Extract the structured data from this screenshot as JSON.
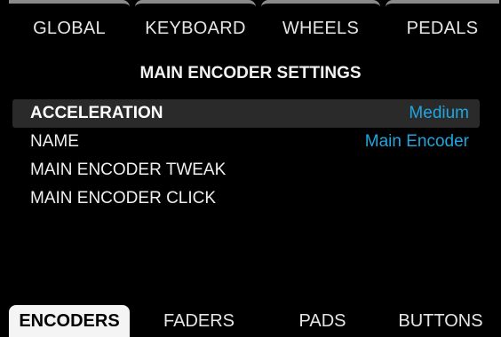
{
  "top_tabs": [
    {
      "label": "GLOBAL"
    },
    {
      "label": "KEYBOARD"
    },
    {
      "label": "WHEELS"
    },
    {
      "label": "PEDALS"
    }
  ],
  "page_title": "MAIN ENCODER SETTINGS",
  "menu": [
    {
      "name": "ACCELERATION",
      "value": "Medium"
    },
    {
      "name": "NAME",
      "value": "Main Encoder"
    },
    {
      "name": "MAIN ENCODER TWEAK"
    },
    {
      "name": "MAIN ENCODER CLICK"
    }
  ],
  "bottom_tabs": [
    {
      "label": "ENCODERS",
      "selected": true
    },
    {
      "label": "FADERS"
    },
    {
      "label": "PADS"
    },
    {
      "label": "BUTTONS"
    }
  ],
  "colors": {
    "background": "#000000",
    "value_accent": "#1fa6e0",
    "selected_row": "#2a2a2a",
    "selected_tab": "#f4f4f4",
    "tab_border": "#8a8a8a"
  }
}
